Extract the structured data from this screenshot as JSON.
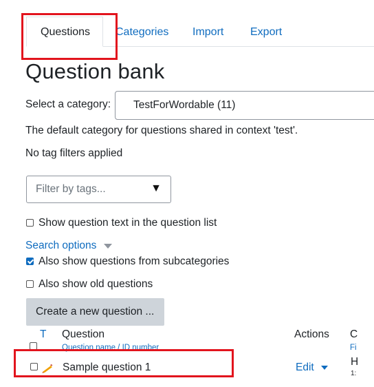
{
  "tabs": [
    {
      "label": "Questions",
      "active": true
    },
    {
      "label": "Categories",
      "active": false
    },
    {
      "label": "Import",
      "active": false
    },
    {
      "label": "Export",
      "active": false
    }
  ],
  "page_title": "Question bank",
  "category": {
    "label": "Select a category:",
    "selected": "TestForWordable (11)"
  },
  "category_description": "The default category for questions shared in context 'test'.",
  "tag_filter_status": "No tag filters applied",
  "tag_filter": {
    "placeholder": "Filter by tags...",
    "arrow": "▼"
  },
  "options": {
    "show_question_text": {
      "label": "Show question text in the question list",
      "checked": false
    },
    "search_options_label": "Search options",
    "subcategories": {
      "label": "Also show questions from subcategories",
      "checked": true
    },
    "old_questions": {
      "label": "Also show old questions",
      "checked": false
    }
  },
  "create_button": "Create a new question ...",
  "table": {
    "col_type": "T",
    "col_question": "Question",
    "col_question_sub": "Question name / ID number",
    "col_actions": "Actions",
    "col_created": "C",
    "col_created_sub": "Fi",
    "rows": [
      {
        "name": "Sample question 1",
        "actions_label": "Edit",
        "created_partial": "H",
        "created_small": "1:"
      }
    ]
  },
  "colors": {
    "accent": "#0f6cbf",
    "highlight": "#e2141d",
    "button_bg": "#ced4da"
  }
}
